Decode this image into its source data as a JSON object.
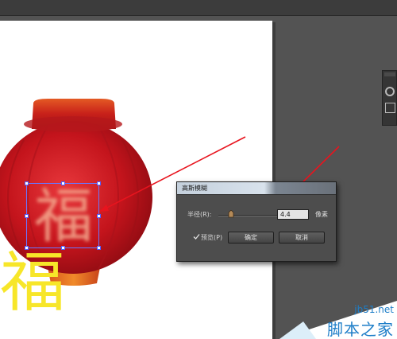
{
  "canvas": {
    "blurred_char": "福",
    "yellow_char": "福"
  },
  "dialog": {
    "title": "高斯模糊",
    "radius_label": "半径(R):",
    "radius_value": "4.4",
    "unit": "像素",
    "preview_label": "预览(P)",
    "preview_checked": true,
    "ok_label": "确定",
    "cancel_label": "取消"
  },
  "watermark": {
    "site": "jb51.net",
    "text": "脚本之家"
  },
  "colors": {
    "lantern_red": "#c4141c",
    "lantern_cap": "#d7421a",
    "yellow_text": "#f7e629",
    "arrow": "#e8141e",
    "selection": "#6a76ff",
    "watermark_blue": "#1e7ec8"
  }
}
